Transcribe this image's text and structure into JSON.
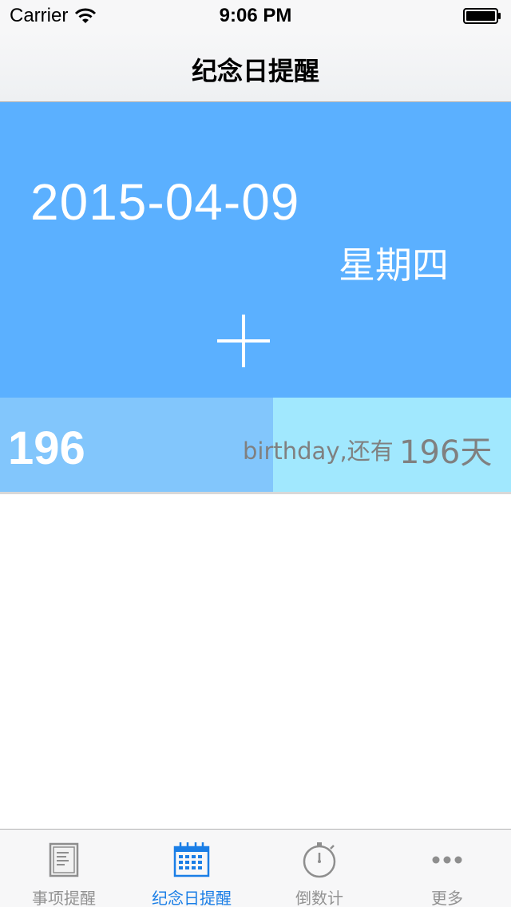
{
  "status_bar": {
    "carrier": "Carrier",
    "time": "9:06 PM"
  },
  "nav": {
    "title": "纪念日提醒"
  },
  "date_panel": {
    "date": "2015-04-09",
    "weekday": "星期四",
    "add_icon": "plus-icon",
    "background_color": "#5bb0ff"
  },
  "countdown": {
    "days_big": "196",
    "event_label": "birthday,还有",
    "days_remaining": "196天",
    "progress_fraction": 0.535,
    "fill_color": "#82c6fc",
    "track_color": "#a1e8fe"
  },
  "tabs": [
    {
      "label": "事项提醒",
      "icon": "document-icon",
      "active": false
    },
    {
      "label": "纪念日提醒",
      "icon": "calendar-icon",
      "active": true
    },
    {
      "label": "倒数计",
      "icon": "stopwatch-icon",
      "active": false
    },
    {
      "label": "更多",
      "icon": "more-icon",
      "active": false
    }
  ],
  "colors": {
    "active_tab": "#1a7ee6",
    "inactive_tab": "#929292"
  }
}
